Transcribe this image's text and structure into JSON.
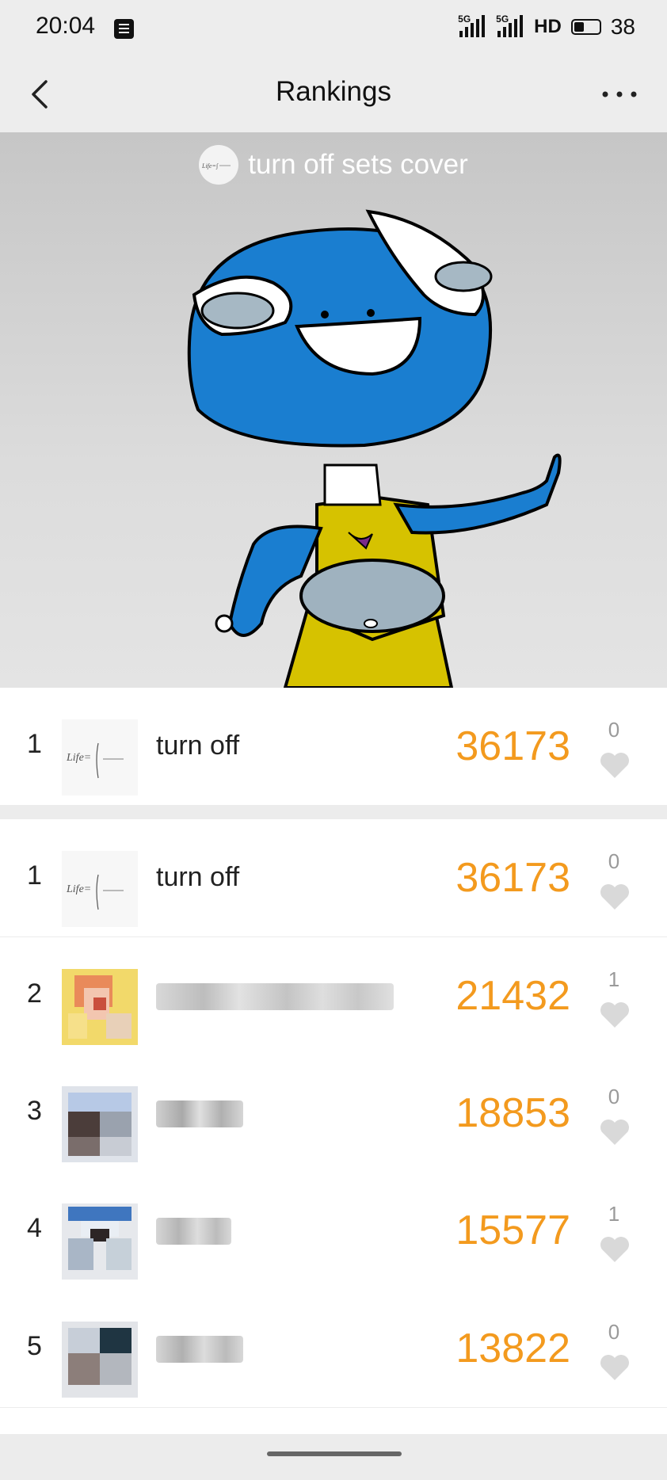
{
  "status_bar": {
    "time": "20:04",
    "network1": "5G",
    "network2": "5G",
    "hd": "HD",
    "battery": "38"
  },
  "header": {
    "title": "Rankings",
    "back_icon": "chevron-left-icon",
    "more_icon": "more-horizontal-icon"
  },
  "cover": {
    "title": "turn off sets cover",
    "avatar_text": "Life="
  },
  "my_rank": {
    "rank": "1",
    "name": "turn off",
    "score": "36173",
    "likes": "0"
  },
  "rankings": [
    {
      "rank": "1",
      "name": "turn off",
      "score": "36173",
      "likes": "0"
    },
    {
      "rank": "2",
      "name": "",
      "score": "21432",
      "likes": "1"
    },
    {
      "rank": "3",
      "name": "",
      "score": "18853",
      "likes": "0"
    },
    {
      "rank": "4",
      "name": "",
      "score": "15577",
      "likes": "1"
    },
    {
      "rank": "5",
      "name": "",
      "score": "13822",
      "likes": "0"
    }
  ],
  "colors": {
    "score": "#f39a1e",
    "header_bg": "#ededed",
    "heart": "#d9d9d9"
  }
}
